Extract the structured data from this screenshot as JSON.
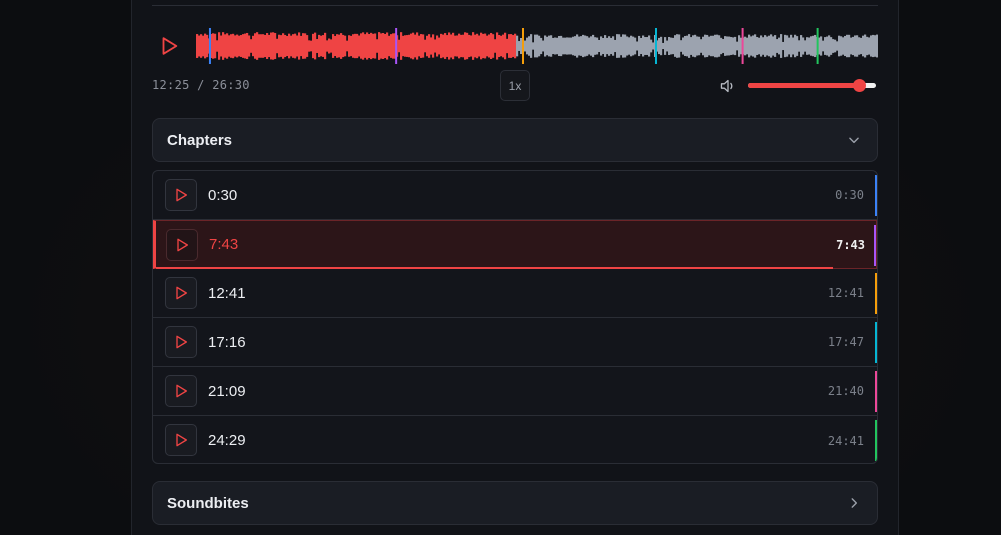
{
  "player": {
    "current_time": "12:25",
    "duration": "26:30",
    "time_separator": " / ",
    "progress_fraction": 0.4686,
    "speed_label": "1x",
    "volume_fraction": 0.87,
    "icons": {
      "play": "play-icon",
      "volume": "volume-icon"
    },
    "chapter_markers": [
      {
        "fraction": 0.019,
        "color": "#3b82f6"
      },
      {
        "fraction": 0.292,
        "color": "#a855f7"
      },
      {
        "fraction": 0.478,
        "color": "#f59e0b"
      },
      {
        "fraction": 0.673,
        "color": "#06b6d4"
      },
      {
        "fraction": 0.8,
        "color": "#ec4899"
      },
      {
        "fraction": 0.91,
        "color": "#22c55e"
      }
    ]
  },
  "chapters": {
    "title": "Chapters",
    "expanded": true,
    "icon": "chevron-down-icon",
    "items": [
      {
        "label": "0:30",
        "time": "0:30",
        "color": "#3b82f6",
        "active": false
      },
      {
        "label": "7:43",
        "time": "7:43",
        "color": "#a855f7",
        "active": true,
        "progress_fraction": 0.94
      },
      {
        "label": "12:41",
        "time": "12:41",
        "color": "#f59e0b",
        "active": false
      },
      {
        "label": "17:16",
        "time": "17:47",
        "color": "#06b6d4",
        "active": false
      },
      {
        "label": "21:09",
        "time": "21:40",
        "color": "#ec4899",
        "active": false
      },
      {
        "label": "24:29",
        "time": "24:41",
        "color": "#22c55e",
        "active": false
      }
    ]
  },
  "soundbites": {
    "title": "Soundbites",
    "expanded": false,
    "icon": "chevron-right-icon"
  },
  "colors": {
    "accent": "#ef4444",
    "waveform_played": "#ef4444",
    "waveform_unplayed": "#9ca3af"
  }
}
